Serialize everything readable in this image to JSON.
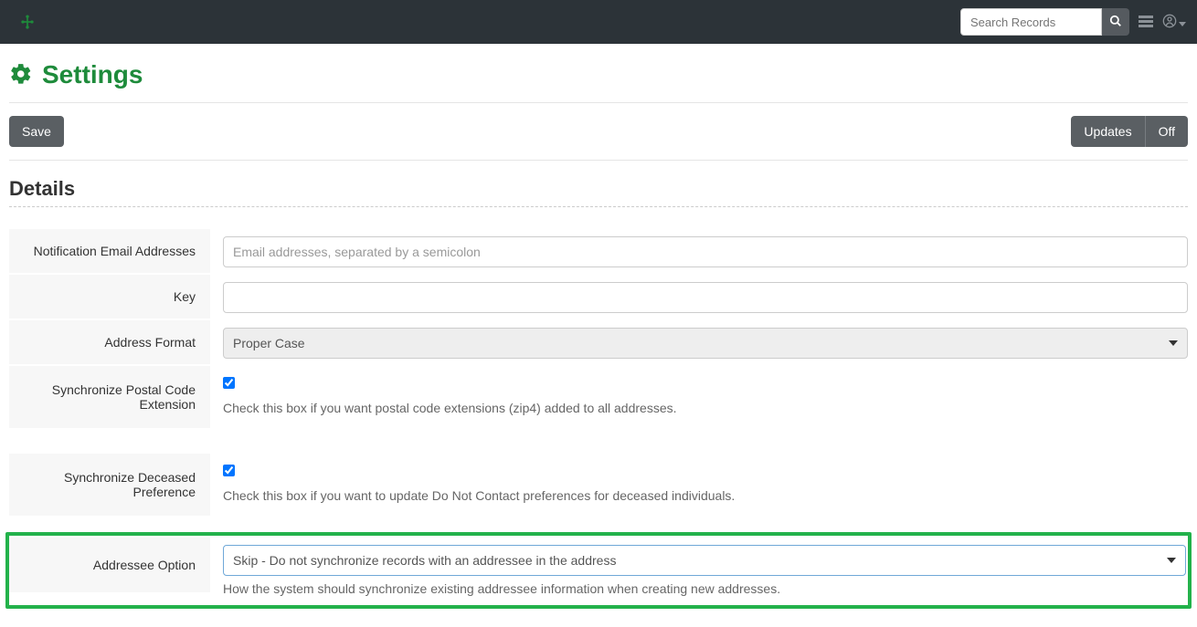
{
  "navbar": {
    "search_placeholder": "Search Records"
  },
  "page": {
    "title": "Settings"
  },
  "actions": {
    "save": "Save",
    "updates": "Updates",
    "off": "Off"
  },
  "section": {
    "details": "Details"
  },
  "fields": {
    "notification_email": {
      "label": "Notification Email Addresses",
      "placeholder": "Email addresses, separated by a semicolon",
      "value": ""
    },
    "key": {
      "label": "Key",
      "value": ""
    },
    "address_format": {
      "label": "Address Format",
      "value": "Proper Case"
    },
    "sync_postal": {
      "label": "Synchronize Postal Code Extension",
      "checked": true,
      "help": "Check this box if you want postal code extensions (zip4) added to all addresses."
    },
    "sync_deceased": {
      "label": "Synchronize Deceased Preference",
      "checked": true,
      "help": "Check this box if you want to update Do Not Contact preferences for deceased individuals."
    },
    "addressee_option": {
      "label": "Addressee Option",
      "value": "Skip - Do not synchronize records with an addressee in the address",
      "help": "How the system should synchronize existing addressee information when creating new addresses."
    }
  }
}
